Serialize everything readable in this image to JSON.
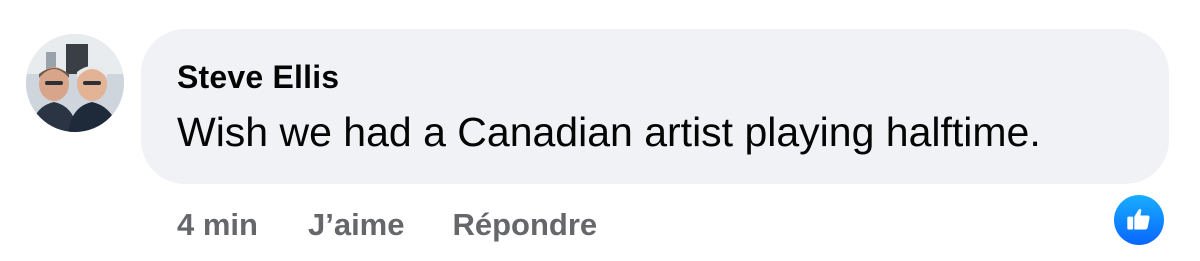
{
  "comment": {
    "author": "Steve Ellis",
    "text": "Wish we had a Canadian artist playing halftime.",
    "time": "4 min",
    "like_label": "J’aime",
    "reply_label": "Répondre"
  },
  "icons": {
    "avatar": "profile-photo",
    "reaction": "thumbs-up-icon"
  },
  "colors": {
    "bubble": "#f0f2f5",
    "text": "#050505",
    "meta": "#65676b",
    "like_badge": "#0866ff"
  }
}
